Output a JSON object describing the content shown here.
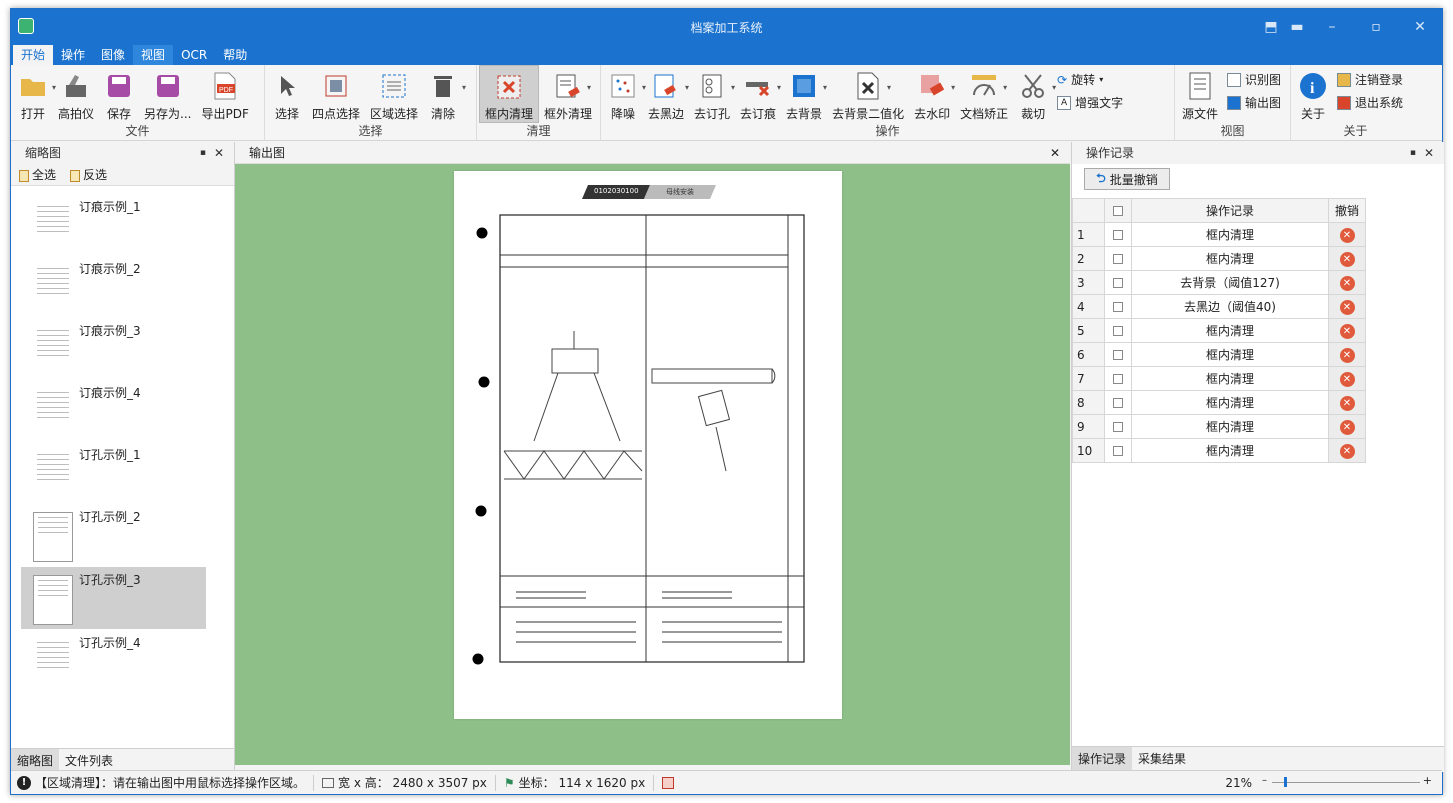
{
  "app": {
    "title": "档案加工系统"
  },
  "menu_tabs": [
    "开始",
    "操作",
    "图像",
    "视图",
    "OCR",
    "帮助"
  ],
  "ribbon": {
    "file": {
      "label": "文件",
      "open": "打开",
      "scanner": "高拍仪",
      "save": "保存",
      "save_as": "另存为...",
      "export_pdf": "导出PDF"
    },
    "select": {
      "label": "选择",
      "select": "选择",
      "four_point": "四点选择",
      "region": "区域选择",
      "clear": "清除"
    },
    "clean": {
      "label": "清理",
      "inner": "框内清理",
      "outer": "框外清理"
    },
    "ops": {
      "label": "操作",
      "denoise": "降噪",
      "black_edge": "去黑边",
      "holes": "去订孔",
      "staple_marks": "去订痕",
      "background": "去背景",
      "bg_binarize": "去背景二值化",
      "watermark": "去水印",
      "deskew": "文档矫正",
      "crop": "裁切",
      "rotate": "旋转",
      "enhance_text": "增强文字"
    },
    "view": {
      "label": "视图",
      "source": "源文件",
      "recognized": "识别图",
      "output": "输出图"
    },
    "about": {
      "label": "关于",
      "about": "关于",
      "logout": "注销登录",
      "exit": "退出系统"
    }
  },
  "left_panel": {
    "title": "缩略图",
    "select_all": "全选",
    "invert": "反选",
    "items": [
      "订痕示例_1",
      "订痕示例_2",
      "订痕示例_3",
      "订痕示例_4",
      "订孔示例_1",
      "订孔示例_2",
      "订孔示例_3",
      "订孔示例_4"
    ],
    "tabs": [
      "缩略图",
      "文件列表"
    ]
  },
  "center_panel": {
    "title": "输出图",
    "doc_code": "0102030100",
    "doc_tag": "母线安装"
  },
  "right_panel": {
    "title": "操作记录",
    "batch_undo": "批量撤销",
    "col_record": "操作记录",
    "col_undo": "撤销",
    "rows": [
      {
        "n": "1",
        "text": "框内清理"
      },
      {
        "n": "2",
        "text": "框内清理"
      },
      {
        "n": "3",
        "text": "去背景（阈值127)"
      },
      {
        "n": "4",
        "text": "去黑边（阈值40)"
      },
      {
        "n": "5",
        "text": "框内清理"
      },
      {
        "n": "6",
        "text": "框内清理"
      },
      {
        "n": "7",
        "text": "框内清理"
      },
      {
        "n": "8",
        "text": "框内清理"
      },
      {
        "n": "9",
        "text": "框内清理"
      },
      {
        "n": "10",
        "text": "框内清理"
      }
    ],
    "tabs": [
      "操作记录",
      "采集结果"
    ]
  },
  "status": {
    "message": "【区域清理】：请在输出图中用鼠标选择操作区域。",
    "size": "宽 x 高： 2480 x 3507 px",
    "coord": "坐标： 114 x 1620 px",
    "zoom": "21%"
  }
}
